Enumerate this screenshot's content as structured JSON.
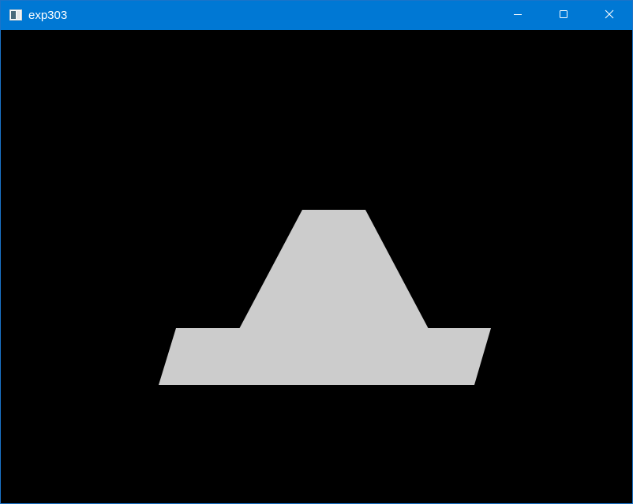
{
  "window": {
    "title": "exp303",
    "titlebar_color": "#0078d4",
    "client_background": "#000000"
  },
  "controls": {
    "minimize_icon": "minimize-icon",
    "maximize_icon": "maximize-icon",
    "close_icon": "close-icon"
  },
  "scene": {
    "shape_color": "#cccccc"
  }
}
